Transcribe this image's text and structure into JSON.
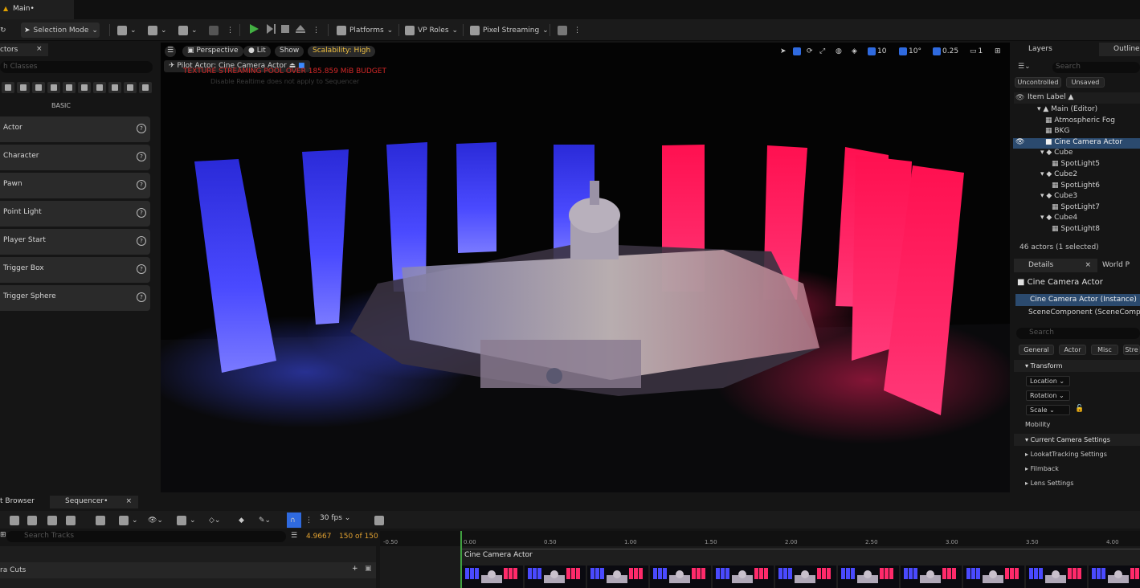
{
  "window": {
    "tab_title": "Main•"
  },
  "toolbar": {
    "selection_mode": "Selection Mode",
    "platforms": "Platforms",
    "vp_roles": "VP Roles",
    "pixel_streaming": "Pixel Streaming"
  },
  "place_actors": {
    "tab_label": "ctors",
    "search_placeholder": "h Classes",
    "category": "BASIC",
    "items": [
      "Actor",
      "Character",
      "Pawn",
      "Point Light",
      "Player Start",
      "Trigger Box",
      "Trigger Sphere"
    ]
  },
  "viewport": {
    "perspective": "Perspective",
    "lit": "Lit",
    "show": "Show",
    "scalability": "Scalability: High",
    "pilot": "Pilot Actor: Cine Camera Actor",
    "texture_warning": "TEXTURE STREAMING POOL OVER 185.859 MiB BUDGET",
    "disabled_msg": "Disable Realtime does not apply to Sequencer",
    "grid_snap": "10",
    "rot_snap": "10°",
    "scale_snap": "0.25",
    "camera_speed": "1"
  },
  "outliner": {
    "layers_tab": "Layers",
    "outliner_tab": "Outliner",
    "search_placeholder": "Search",
    "filter_uncontrolled": "Uncontrolled",
    "filter_unsaved": "Unsaved",
    "column_header": "Item Label ▲",
    "rows": [
      {
        "label": "Main (Editor)"
      },
      {
        "label": "Atmospheric Fog"
      },
      {
        "label": "BKG"
      },
      {
        "label": "Cine Camera Actor"
      },
      {
        "label": "Cube"
      },
      {
        "label": "SpotLight5"
      },
      {
        "label": "Cube2"
      },
      {
        "label": "SpotLight6"
      },
      {
        "label": "Cube3"
      },
      {
        "label": "SpotLight7"
      },
      {
        "label": "Cube4"
      },
      {
        "label": "SpotLight8"
      }
    ],
    "count": "46 actors (1 selected)"
  },
  "details": {
    "tab": "Details",
    "world_tab": "World P",
    "actor_name": "Cine Camera Actor",
    "instance": "Cine Camera Actor (Instance)",
    "component": "SceneComponent (SceneComp",
    "search_placeholder": "Search",
    "chips": [
      "General",
      "Actor",
      "Misc",
      "Stre"
    ],
    "transform_header": "Transform",
    "location": "Location",
    "rotation": "Rotation",
    "scale": "Scale",
    "mobility": "Mobility",
    "camera_settings": "Current Camera Settings",
    "lookat": "LookatTracking Settings",
    "filmback": "Filmback",
    "lens": "Lens Settings"
  },
  "bottom": {
    "content_browser_tab": "t Browser",
    "sequencer_tab": "Sequencer•",
    "fps": "30 fps",
    "search_tracks": "Search Tracks",
    "current_time": "4.9667",
    "frame_count": "150 of 150",
    "track_label": "ra Cuts",
    "clip_label": "Cine Camera Actor",
    "ticks": [
      "-0.50",
      "0.00",
      "0.50",
      "1.00",
      "1.50",
      "2.00",
      "2.50",
      "3.00",
      "3.50",
      "4.00"
    ]
  },
  "colors": {
    "accent": "#2b4a6e",
    "warning": "#d42828",
    "scalability": "#f0c040",
    "playhead": "#40a040"
  }
}
